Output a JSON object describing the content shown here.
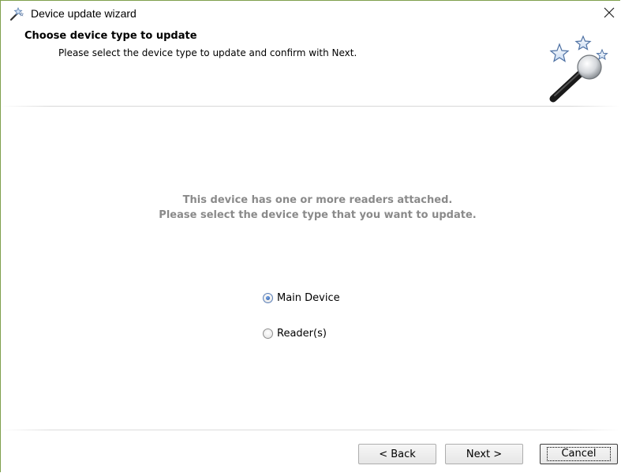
{
  "window": {
    "title": "Device update wizard",
    "close_glyph": "✕",
    "title_icon": "magic-wand-icon"
  },
  "header": {
    "title": "Choose device type to update",
    "subtitle": "Please select the device type to update and confirm with Next.",
    "graphic": "magic-wand-stars-icon"
  },
  "main": {
    "message_line1": "This device has one or more readers attached.",
    "message_line2": "Please select the device type that you want to update.",
    "options": [
      {
        "label": "Main Device",
        "selected": true
      },
      {
        "label": "Reader(s)",
        "selected": false
      }
    ]
  },
  "footer": {
    "back_label": "< Back",
    "next_label": "Next >",
    "cancel_label": "Cancel"
  },
  "colors": {
    "window_border": "#7fa04d",
    "message_text": "#8a8a8a",
    "radio_accent": "#2c5fb0"
  }
}
